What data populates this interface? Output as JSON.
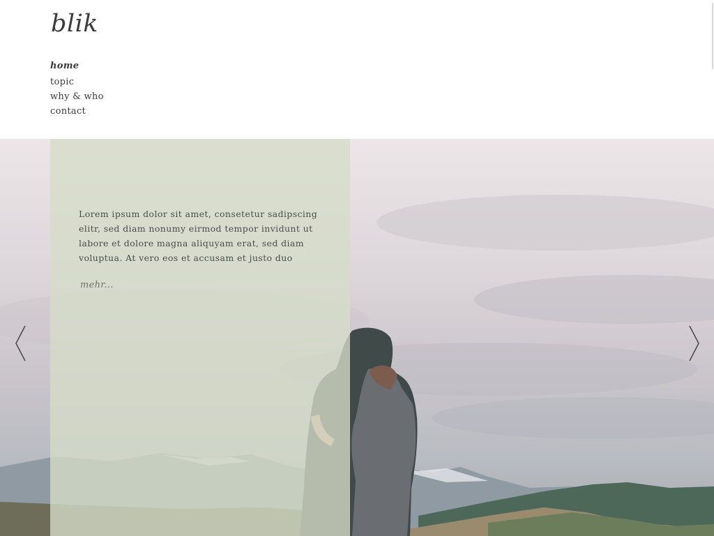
{
  "header": {
    "logo": "blik",
    "nav": [
      {
        "label": "home",
        "active": true
      },
      {
        "label": "topic",
        "active": false
      },
      {
        "label": "why & who",
        "active": false
      },
      {
        "label": "contact",
        "active": false
      }
    ]
  },
  "hero": {
    "intro_text": "Lorem ipsum dolor sit amet, consetetur sadipscing elitr, sed diam nonumy eirmod tempor invidunt ut labore et dolore magna aliquyam erat, sed diam voluptua. At vero eos et accusam et justo duo",
    "more_link": "mehr...",
    "prev_icon": "chevron-left-icon",
    "next_icon": "chevron-right-icon"
  },
  "colors": {
    "panel": "#d6dcc8",
    "text": "#3a3a3a",
    "link": "#6f7466"
  }
}
